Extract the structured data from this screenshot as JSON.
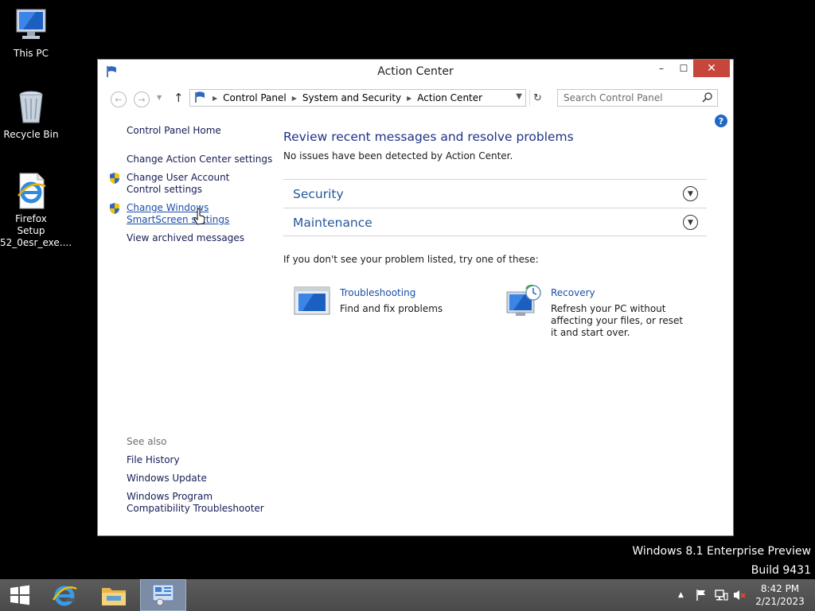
{
  "desktop": {
    "icons": [
      {
        "label": "This PC",
        "icon": "computer-icon"
      },
      {
        "label": "Recycle Bin",
        "icon": "recycle-bin-icon"
      },
      {
        "label": "Firefox Setup 52_0esr_exe....",
        "icon": "ie-file-icon"
      }
    ]
  },
  "window": {
    "title": "Action Center",
    "minimize": "–",
    "maximize": "☐",
    "close": "✕",
    "breadcrumb": [
      "Control Panel",
      "System and Security",
      "Action Center"
    ],
    "search_placeholder": "Search Control Panel",
    "help": "?"
  },
  "left_pane": {
    "home": "Control Panel Home",
    "links": [
      "Change Action Center settings",
      "Change User Account Control settings",
      "Change Windows SmartScreen settings",
      "View archived messages"
    ],
    "see_also_heading": "See also",
    "see_also": [
      "File History",
      "Windows Update",
      "Windows Program Compatibility Troubleshooter"
    ]
  },
  "main": {
    "heading": "Review recent messages and resolve problems",
    "status": "No issues have been detected by Action Center.",
    "sections": [
      "Security",
      "Maintenance"
    ],
    "try_text": "If you don't see your problem listed, try one of these:",
    "tools": [
      {
        "title": "Troubleshooting",
        "description": "Find and fix problems"
      },
      {
        "title": "Recovery",
        "description": "Refresh your PC without affecting your files, or reset it and start over."
      }
    ]
  },
  "watermark": {
    "line1": "Windows 8.1 Enterprise Preview",
    "line2": "Build 9431"
  },
  "taskbar": {
    "time": "8:42 PM",
    "date": "2/21/2023"
  },
  "colors": {
    "link": "#1c4ea8",
    "heading": "#1e3287",
    "close_button": "#c7463b",
    "taskbar": "#4a4a4a"
  }
}
